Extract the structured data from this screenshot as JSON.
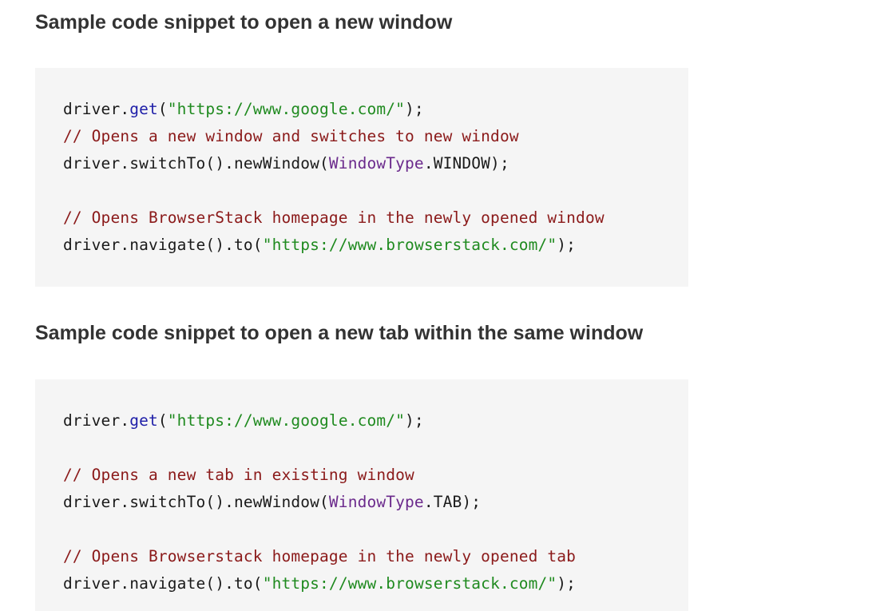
{
  "headings": {
    "new_window": "Sample code snippet to open a new window",
    "new_tab": "Sample code snippet to open a new tab within the same window"
  },
  "colors": {
    "background": "#ffffff",
    "code_background": "#f5f5f5",
    "heading_text": "#333333",
    "method": "#1e1ea8",
    "string": "#1f8a1f",
    "comment": "#8b1a1a",
    "type": "#6b2a8c",
    "plain": "#1a1a1a"
  },
  "code_window": {
    "line1": {
      "a": "driver.",
      "b": "get",
      "c": "(",
      "d": "\"https://www.google.com/\"",
      "e": ");"
    },
    "line2": {
      "comment": "// Opens a new window and switches to new window"
    },
    "line3": {
      "a": "driver.switchTo().newWindow(",
      "b": "WindowType",
      "c": ".WINDOW);"
    },
    "line4": {
      "comment": "// Opens BrowserStack homepage in the newly opened window"
    },
    "line5": {
      "a": "driver.navigate().to(",
      "b": "\"https://www.browserstack.com/\"",
      "c": ");"
    }
  },
  "code_tab": {
    "line1": {
      "a": "driver.",
      "b": "get",
      "c": "(",
      "d": "\"https://www.google.com/\"",
      "e": ");"
    },
    "line2": {
      "comment": "// Opens a new tab in existing window"
    },
    "line3": {
      "a": "driver.switchTo().newWindow(",
      "b": "WindowType",
      "c": ".TAB);"
    },
    "line4": {
      "comment": "// Opens Browserstack homepage in the newly opened tab"
    },
    "line5": {
      "a": "driver.navigate().to(",
      "b": "\"https://www.browserstack.com/\"",
      "c": ");"
    }
  }
}
